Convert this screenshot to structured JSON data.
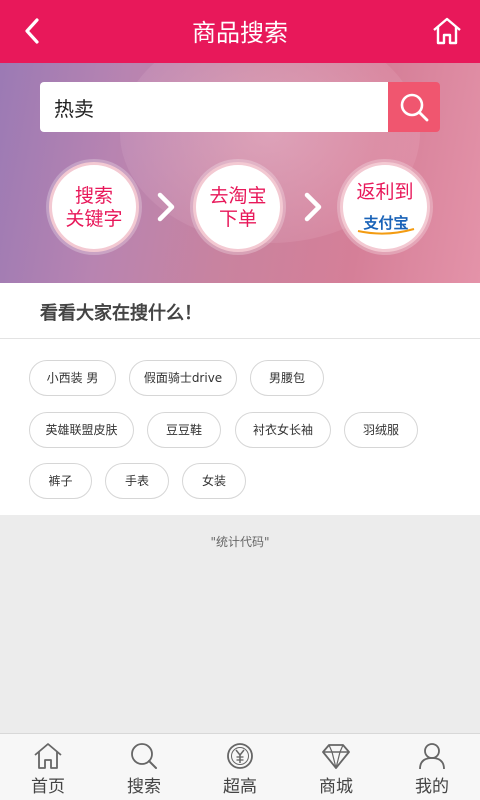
{
  "header": {
    "title": "商品搜索",
    "back_icon": "back-arrow-icon",
    "home_icon": "home-icon",
    "color": "#e8185a"
  },
  "search": {
    "value": "热卖",
    "button_icon": "search-icon",
    "button_color": "#f0566f"
  },
  "steps": [
    {
      "line1": "搜索",
      "line2": "关键字"
    },
    {
      "line1": "去淘宝",
      "line2": "下单"
    },
    {
      "line1": "返利到",
      "logo_text": "支付宝"
    }
  ],
  "hot": {
    "title": "看看大家在搜什么！",
    "tags": [
      "小西装 男",
      "假面骑士drive",
      "男腰包",
      "英雄联盟皮肤",
      "豆豆鞋",
      "衬衣女长袖",
      "羽绒服",
      "裤子",
      "手表",
      "女装"
    ]
  },
  "stats_text": "\"统计代码\"",
  "tabbar": [
    {
      "label": "首页",
      "icon": "home-icon"
    },
    {
      "label": "搜索",
      "icon": "search-icon"
    },
    {
      "label": "超高",
      "icon": "yen-coin-icon"
    },
    {
      "label": "商城",
      "icon": "diamond-icon"
    },
    {
      "label": "我的",
      "icon": "user-icon"
    }
  ]
}
